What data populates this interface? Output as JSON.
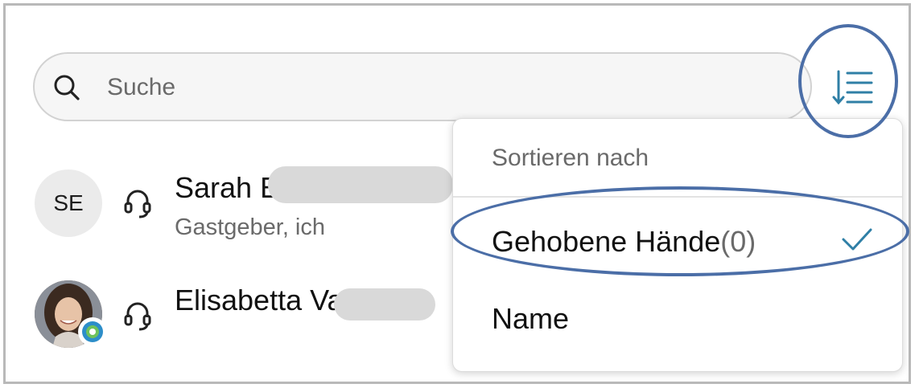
{
  "search": {
    "placeholder": "Suche",
    "icon": "search-icon"
  },
  "sort_button": {
    "icon": "sort-list-icon",
    "accent_color": "#2f7fa6"
  },
  "participants": [
    {
      "initials": "SE",
      "name": "Sarah Ec",
      "role": "Gastgeber, ich",
      "icon": "headset-icon"
    },
    {
      "name": "Elisabetta Valgel",
      "icon": "headset-icon",
      "avatar": "photo"
    }
  ],
  "sort_menu": {
    "header": "Sortieren nach",
    "items": [
      {
        "label": "Gehobene Hände",
        "count": "(0)",
        "selected": true
      },
      {
        "label": "Name",
        "selected": false
      }
    ]
  },
  "colors": {
    "annotation": "#4b6ea7",
    "check": "#2f7fa6",
    "frame": "#b9b9b9"
  }
}
